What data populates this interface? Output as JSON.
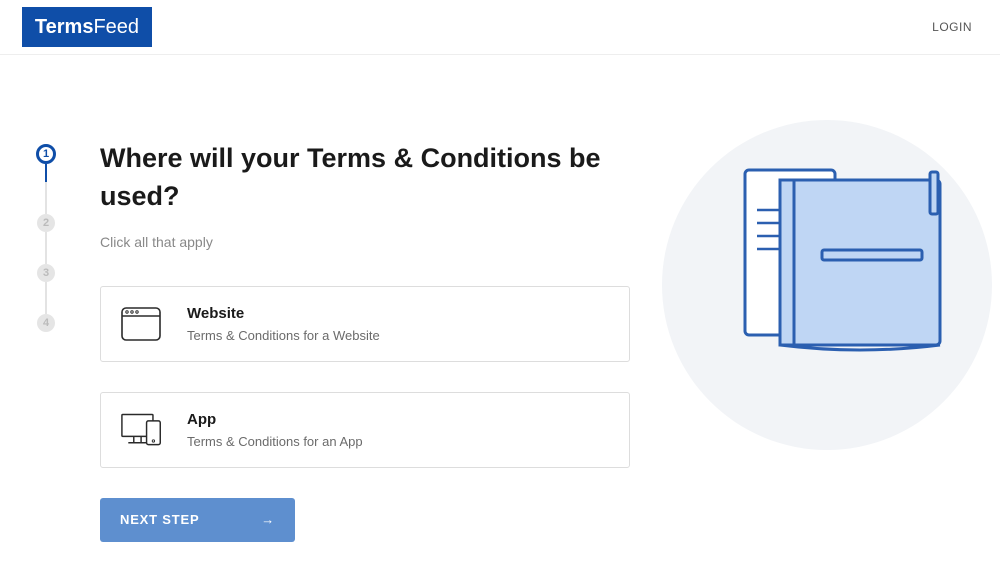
{
  "header": {
    "logo_part1": "Terms",
    "logo_part2": "Feed",
    "login": "LOGIN"
  },
  "stepper": {
    "steps": [
      "1",
      "2",
      "3",
      "4"
    ],
    "active_index": 0
  },
  "content": {
    "title": "Where will your Terms & Conditions be used?",
    "subtitle": "Click all that apply",
    "options": [
      {
        "title": "Website",
        "desc": "Terms & Conditions for a Website"
      },
      {
        "title": "App",
        "desc": "Terms & Conditions for an App"
      }
    ],
    "next_button": "NEXT STEP"
  }
}
